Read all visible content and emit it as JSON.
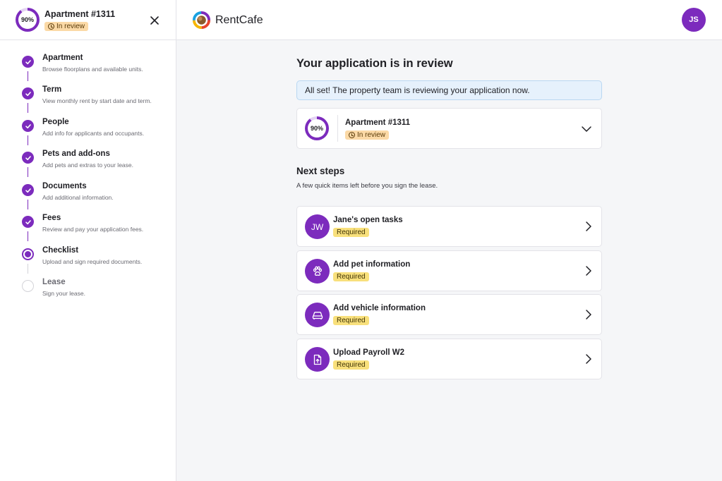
{
  "sidebar": {
    "progress_percent": 90,
    "progress_label": "90%",
    "apartment_title": "Apartment #1311",
    "status_label": "In review",
    "steps": [
      {
        "title": "Apartment",
        "subtitle": "Browse floorplans and available units.",
        "state": "done"
      },
      {
        "title": "Term",
        "subtitle": "View monthly rent by start date and term.",
        "state": "done"
      },
      {
        "title": "People",
        "subtitle": "Add info for applicants and occupants.",
        "state": "done"
      },
      {
        "title": "Pets and add-ons",
        "subtitle": "Add pets and extras to your lease.",
        "state": "done"
      },
      {
        "title": "Documents",
        "subtitle": "Add additional information.",
        "state": "done"
      },
      {
        "title": "Fees",
        "subtitle": "Review and pay your application fees.",
        "state": "done"
      },
      {
        "title": "Checklist",
        "subtitle": "Upload and sign required documents.",
        "state": "current"
      },
      {
        "title": "Lease",
        "subtitle": "Sign your lease.",
        "state": "todo"
      }
    ]
  },
  "header": {
    "brand": "RentCafe",
    "user_initials": "JS"
  },
  "main": {
    "title": "Your application is in review",
    "notice": "All set! The property team is reviewing your application now.",
    "apartment_card": {
      "progress_label": "90%",
      "title": "Apartment #1311",
      "status_label": "In review"
    },
    "next_steps_title": "Next steps",
    "next_steps_subtitle": "A few quick items left before you sign the lease.",
    "tasks": [
      {
        "title": "Jane's open tasks",
        "badge": "Required",
        "icon": "initials",
        "initials": "JW"
      },
      {
        "title": "Add pet information",
        "badge": "Required",
        "icon": "paw-icon"
      },
      {
        "title": "Add vehicle information",
        "badge": "Required",
        "icon": "car-icon"
      },
      {
        "title": "Upload Payroll W2",
        "badge": "Required",
        "icon": "file-upload-icon"
      }
    ]
  },
  "colors": {
    "accent": "#7c2bbd",
    "review_badge": "#fbd9a6",
    "required_badge": "#f8e07c",
    "notice_bg": "#e6f1fc"
  }
}
